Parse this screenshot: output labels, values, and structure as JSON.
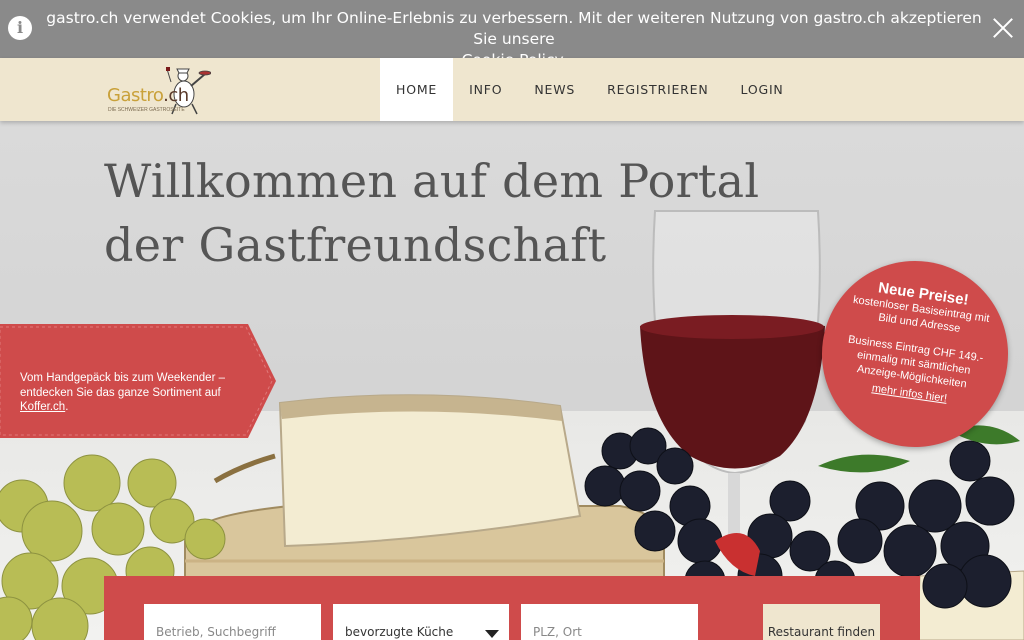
{
  "cookie": {
    "text": "gastro.ch verwendet Cookies, um Ihr Online-Erlebnis zu verbessern. Mit der weiteren Nutzung von gastro.ch akzeptieren Sie unsere",
    "link": "Cookie Policy",
    "period": "."
  },
  "header": {
    "logo_main": "Gastro",
    "logo_suffix": ".ch",
    "logo_sub": "DIE SCHWEIZER GASTROSEITE",
    "nav": [
      "HOME",
      "INFO",
      "NEWS",
      "REGISTRIEREN",
      "LOGIN"
    ]
  },
  "hero": {
    "title_line1": "Willkommen auf dem Portal",
    "title_line2": "der Gastfreundschaft"
  },
  "promo": {
    "text": "Vom Handgepäck bis zum Weekender – entdecken Sie das ganze Sortiment auf",
    "link": "Koffer.ch",
    "period": "."
  },
  "badge": {
    "title": "Neue Preise!",
    "line1": "kostenloser Basiseintrag mit",
    "line2": "Bild und Adresse",
    "line3": "Business Eintrag CHF 149.-",
    "line4": "einmalig mit sämtlichen",
    "line5": "Anzeige-Möglichkeiten",
    "link": "mehr infos hier!"
  },
  "search": {
    "term_placeholder": "Betrieb, Suchbegriff",
    "cuisine_value": "bevorzugte Küche",
    "location_placeholder": "PLZ, Ort",
    "button": "Restaurant finden"
  },
  "colors": {
    "accent_red": "#cf4b4b",
    "header_beige": "#efe6cf",
    "cookie_gray": "#8a8a8a"
  }
}
